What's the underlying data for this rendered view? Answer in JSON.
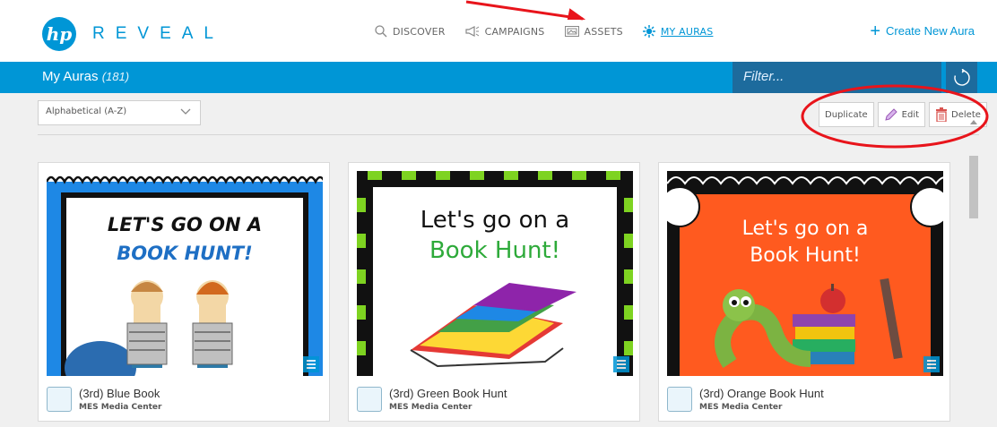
{
  "logo": {
    "mark": "hp",
    "text": "REVEAL"
  },
  "nav": {
    "items": [
      {
        "label": "DISCOVER",
        "icon": "search-icon"
      },
      {
        "label": "CAMPAIGNS",
        "icon": "megaphone-icon"
      },
      {
        "label": "ASSETS",
        "icon": "image-icon"
      },
      {
        "label": "MY AURAS",
        "icon": "aura-icon",
        "active": true
      }
    ],
    "create_label": "Create New Aura"
  },
  "header": {
    "title": "My Auras",
    "count": "(181)",
    "filter_placeholder": "Filter..."
  },
  "toolbar": {
    "sort_value": "Alphabetical (A-Z)",
    "duplicate_label": "Duplicate",
    "edit_label": "Edit",
    "delete_label": "Delete"
  },
  "cards": [
    {
      "title": "(3rd) Blue Book",
      "owner": "MES Media Center",
      "thumb_text_1": "LET'S GO ON A",
      "thumb_text_2": "BOOK HUNT!"
    },
    {
      "title": "(3rd) Green Book Hunt",
      "owner": "MES Media Center",
      "thumb_text_1": "Let's go on a",
      "thumb_text_2": "Book Hunt!"
    },
    {
      "title": "(3rd) Orange Book Hunt",
      "owner": "MES Media Center",
      "thumb_text_1": "Let's go on a",
      "thumb_text_2": "Book Hunt!"
    }
  ],
  "colors": {
    "brand": "#0096d6",
    "bar_dark": "#1d6b9d",
    "annotation": "#e8141b",
    "delete": "#d9534f",
    "edit": "#b06ad0"
  }
}
